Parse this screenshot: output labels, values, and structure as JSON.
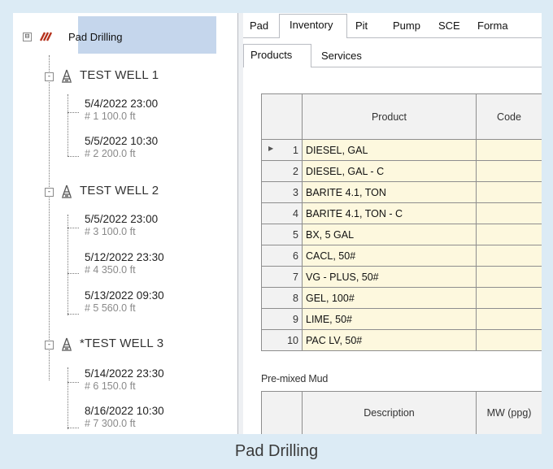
{
  "caption": "Pad Drilling",
  "tree": {
    "root": {
      "label": "Pad Drilling",
      "expander": "⊟"
    },
    "wells": [
      {
        "label": "TEST WELL 1",
        "entries": [
          {
            "date": "5/4/2022 23:00",
            "detail": "# 1  100.0 ft"
          },
          {
            "date": "5/5/2022 10:30",
            "detail": "# 2  200.0 ft"
          }
        ]
      },
      {
        "label": "TEST WELL 2",
        "entries": [
          {
            "date": "5/5/2022 23:00",
            "detail": "# 3  100.0 ft"
          },
          {
            "date": "5/12/2022 23:30",
            "detail": "# 4  350.0 ft"
          },
          {
            "date": "5/13/2022 09:30",
            "detail": "# 5  560.0 ft"
          }
        ]
      },
      {
        "label": "*TEST WELL 3",
        "entries": [
          {
            "date": "5/14/2022 23:30",
            "detail": "# 6  150.0 ft"
          },
          {
            "date": "8/16/2022 10:30",
            "detail": "# 7  300.0 ft"
          }
        ]
      }
    ]
  },
  "tabs": [
    "Pad",
    "Inventory",
    "Pit",
    "Pump",
    "SCE",
    "Forma"
  ],
  "active_tab": "Inventory",
  "subtabs": [
    "Products",
    "Services"
  ],
  "active_subtab": "Products",
  "products_table": {
    "columns": [
      "",
      "Product",
      "Code"
    ],
    "rows": [
      {
        "n": "1",
        "product": "DIESEL, GAL",
        "code": ""
      },
      {
        "n": "2",
        "product": "DIESEL, GAL - C",
        "code": ""
      },
      {
        "n": "3",
        "product": "BARITE 4.1, TON",
        "code": ""
      },
      {
        "n": "4",
        "product": "BARITE 4.1, TON - C",
        "code": ""
      },
      {
        "n": "5",
        "product": "BX, 5 GAL",
        "code": ""
      },
      {
        "n": "6",
        "product": "CACL, 50#",
        "code": ""
      },
      {
        "n": "7",
        "product": "VG - PLUS, 50#",
        "code": ""
      },
      {
        "n": "8",
        "product": "GEL, 100#",
        "code": ""
      },
      {
        "n": "9",
        "product": "LIME, 50#",
        "code": ""
      },
      {
        "n": "10",
        "product": "PAC LV, 50#",
        "code": ""
      }
    ],
    "current_row_marker": "▶"
  },
  "premixed": {
    "label": "Pre-mixed Mud",
    "columns": [
      "",
      "Description",
      "MW (ppg)"
    ]
  },
  "colors": {
    "selection": "#c5d6ec",
    "editable_cell": "#fdf8de",
    "page_background": "#dcebf5",
    "root_icon": "#b5321d"
  }
}
